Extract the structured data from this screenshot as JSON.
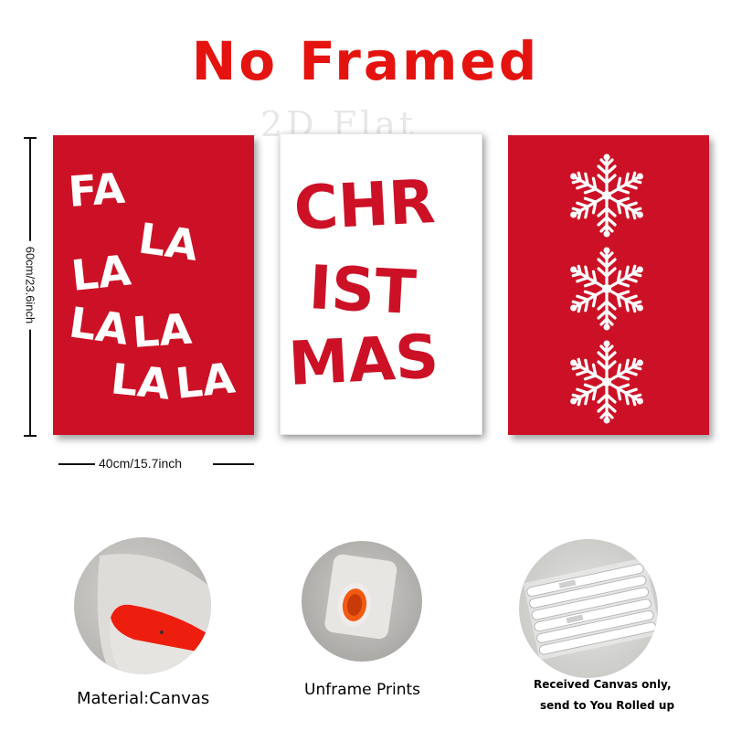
{
  "headline": "No Framed",
  "watermark": "2D Flat",
  "dimensions": {
    "height_label": "60cm/23.6inch",
    "width_label": "40cm/15.7inch"
  },
  "panels": [
    {
      "name": "fa-la-la-print",
      "words": [
        "FA",
        "LA",
        "LA",
        "LA",
        "LA",
        "LA",
        "LA"
      ]
    },
    {
      "name": "christmas-print",
      "words": [
        "CHR",
        "IST",
        "MAS"
      ]
    },
    {
      "name": "snowflake-print",
      "icons": [
        "snowflake-icon",
        "snowflake-icon",
        "snowflake-icon"
      ]
    }
  ],
  "features": [
    {
      "caption": "Material:Canvas",
      "icon": "canvas-material-photo"
    },
    {
      "caption": "Unframe  Prints",
      "icon": "rolled-print-photo"
    },
    {
      "caption_lines": [
        "Received Canvas only,",
        "send to You Rolled up"
      ],
      "icon": "rolled-tubes-photo"
    }
  ],
  "colors": {
    "headline_red": "#e5130f",
    "panel_red": "#cc1126",
    "white": "#ffffff"
  }
}
